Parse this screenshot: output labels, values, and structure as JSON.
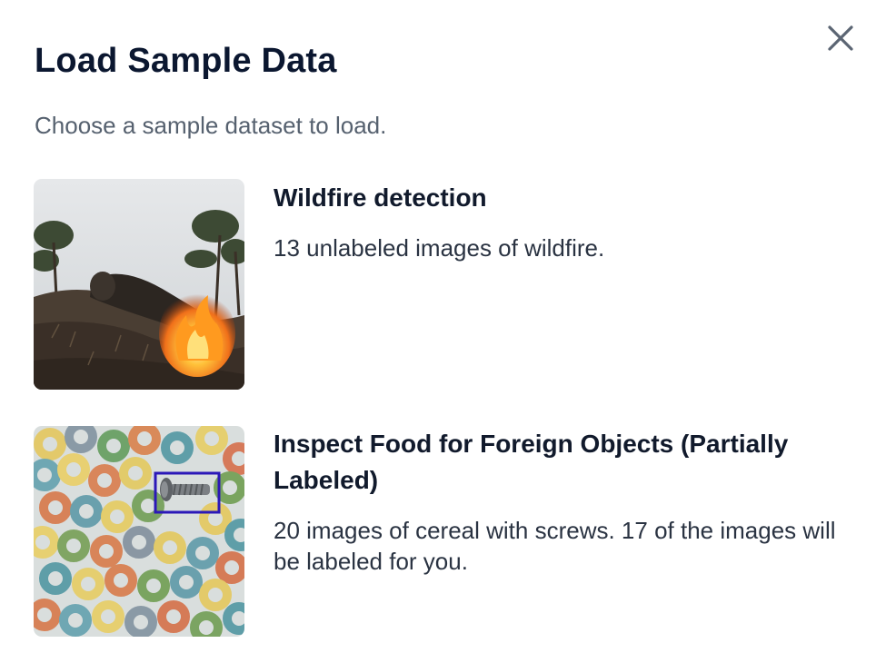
{
  "dialog": {
    "title": "Load Sample Data",
    "subtitle": "Choose a sample dataset to load.",
    "close_icon": "close-icon"
  },
  "datasets": [
    {
      "title": "Wildfire detection",
      "description": "13 unlabeled images of wildfire.",
      "thumbnail": "wildfire-thumbnail"
    },
    {
      "title": "Inspect Food for Foreign Objects (Partially Labeled)",
      "description": "20 images of cereal with screws. 17 of the images will be labeled for you.",
      "thumbnail": "cereal-screws-thumbnail"
    }
  ],
  "colors": {
    "title": "#0b1730",
    "subtitle": "#56616f",
    "bounding_box": "#2b18b8",
    "close_icon": "#5b6573"
  }
}
